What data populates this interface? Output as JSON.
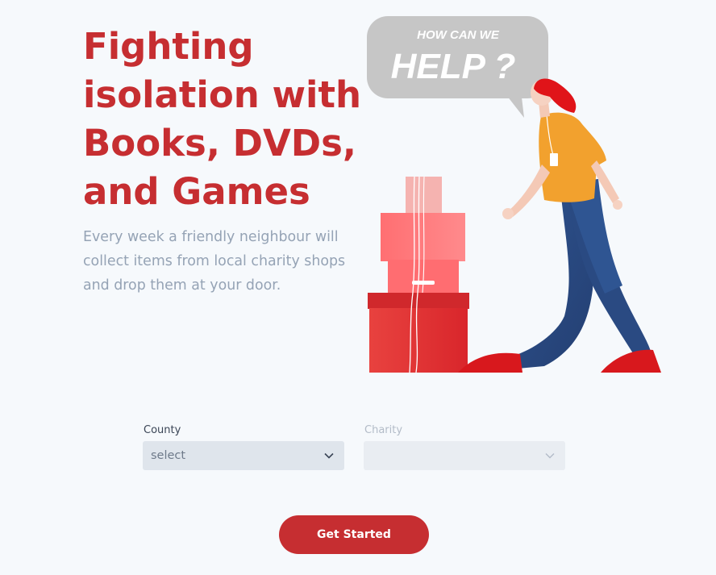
{
  "hero": {
    "title_lines": [
      "Fighting",
      "isolation with",
      "Books, DVDs,",
      "and Games"
    ],
    "description_lines": [
      "Every week a friendly neighbour will",
      "collect items from local charity shops",
      "and drop them at your door."
    ]
  },
  "illustration": {
    "bubble_small": "HOW CAN WE",
    "bubble_large": "HELP ?"
  },
  "form": {
    "county": {
      "label": "County",
      "value": "select"
    },
    "charity": {
      "label": "Charity",
      "value": ""
    }
  },
  "cta": {
    "label": "Get Started"
  },
  "colors": {
    "brand": "#c62e31",
    "background": "#f6f9fc",
    "muted_text": "#95a3b5"
  }
}
